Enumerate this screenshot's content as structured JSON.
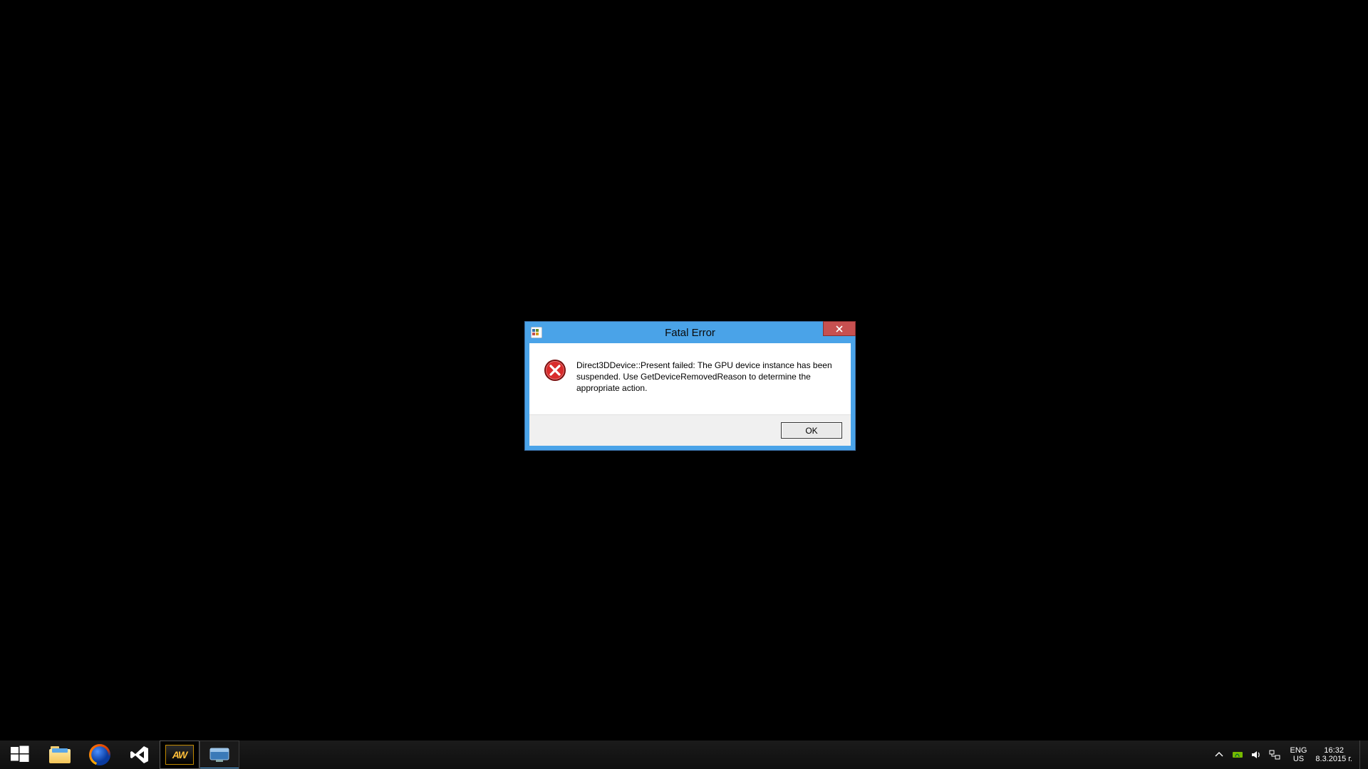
{
  "dialog": {
    "title": "Fatal Error",
    "message": "Direct3DDevice::Present failed: The GPU device instance has been suspended. Use GetDeviceRemovedReason to determine the appropriate action.",
    "ok_label": "OK"
  },
  "taskbar": {
    "tray": {
      "lang_primary": "ENG",
      "lang_secondary": "US",
      "time": "16:32",
      "date": "8.3.2015 г."
    }
  }
}
